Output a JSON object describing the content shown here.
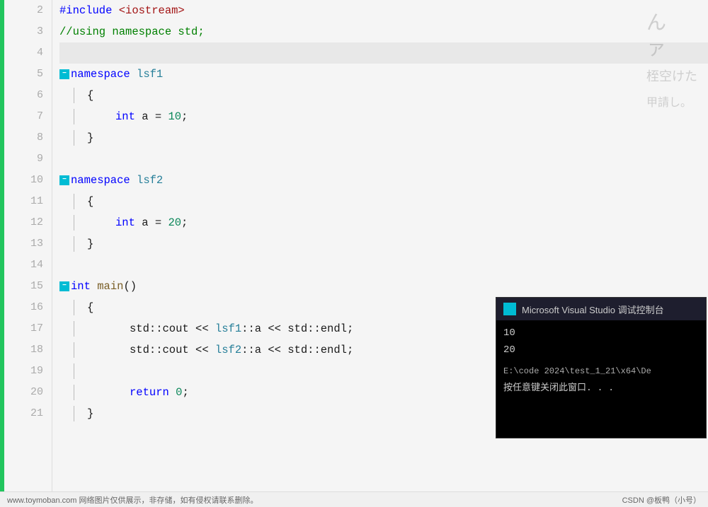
{
  "editor": {
    "lines": [
      {
        "num": "2",
        "content": "preprocessor",
        "text": "#include <iostream>"
      },
      {
        "num": "3",
        "content": "comment",
        "text": "//using namespace std;"
      },
      {
        "num": "4",
        "content": "empty",
        "text": ""
      },
      {
        "num": "5",
        "content": "namespace",
        "text": "namespace lsf1",
        "collapse": true
      },
      {
        "num": "6",
        "content": "brace",
        "text": "{",
        "indent": 1
      },
      {
        "num": "7",
        "content": "declaration",
        "text": "int a = 10;",
        "indent": 2
      },
      {
        "num": "8",
        "content": "brace",
        "text": "}",
        "indent": 1
      },
      {
        "num": "9",
        "content": "empty",
        "text": ""
      },
      {
        "num": "10",
        "content": "namespace",
        "text": "namespace lsf2",
        "collapse": true
      },
      {
        "num": "11",
        "content": "brace",
        "text": "{",
        "indent": 1
      },
      {
        "num": "12",
        "content": "declaration",
        "text": "int a = 20;",
        "indent": 2
      },
      {
        "num": "13",
        "content": "brace",
        "text": "}",
        "indent": 1
      },
      {
        "num": "14",
        "content": "empty",
        "text": ""
      },
      {
        "num": "15",
        "content": "function",
        "text": "int main()",
        "collapse": true
      },
      {
        "num": "16",
        "content": "brace",
        "text": "{",
        "indent": 1
      },
      {
        "num": "17",
        "content": "statement",
        "text": "std::cout << lsf1::a << std::endl;",
        "indent": 2
      },
      {
        "num": "18",
        "content": "statement",
        "text": "std::cout << lsf2::a << std::endl;",
        "indent": 2
      },
      {
        "num": "19",
        "content": "empty",
        "text": "",
        "indent": 2
      },
      {
        "num": "20",
        "content": "return",
        "text": "return 0;",
        "indent": 2
      },
      {
        "num": "21",
        "content": "brace",
        "text": "}",
        "indent": 1
      }
    ]
  },
  "console": {
    "title": "Microsoft Visual Studio 调试控制台",
    "icon_label": "VS",
    "output_lines": [
      "10",
      "20",
      "",
      "E:\\code 2024\\test_1_21\\x64\\De",
      "按任意键关闭此窗口. . ."
    ]
  },
  "bottom_bar": {
    "left_text": "www.toymoban.com 网络图片仅供展示，非存储，如有侵权请联系删除。",
    "right_text": "CSDN @板鸭（小号）"
  },
  "anime_overlay": {
    "chars": "んァ桎空けた甲請し。"
  }
}
